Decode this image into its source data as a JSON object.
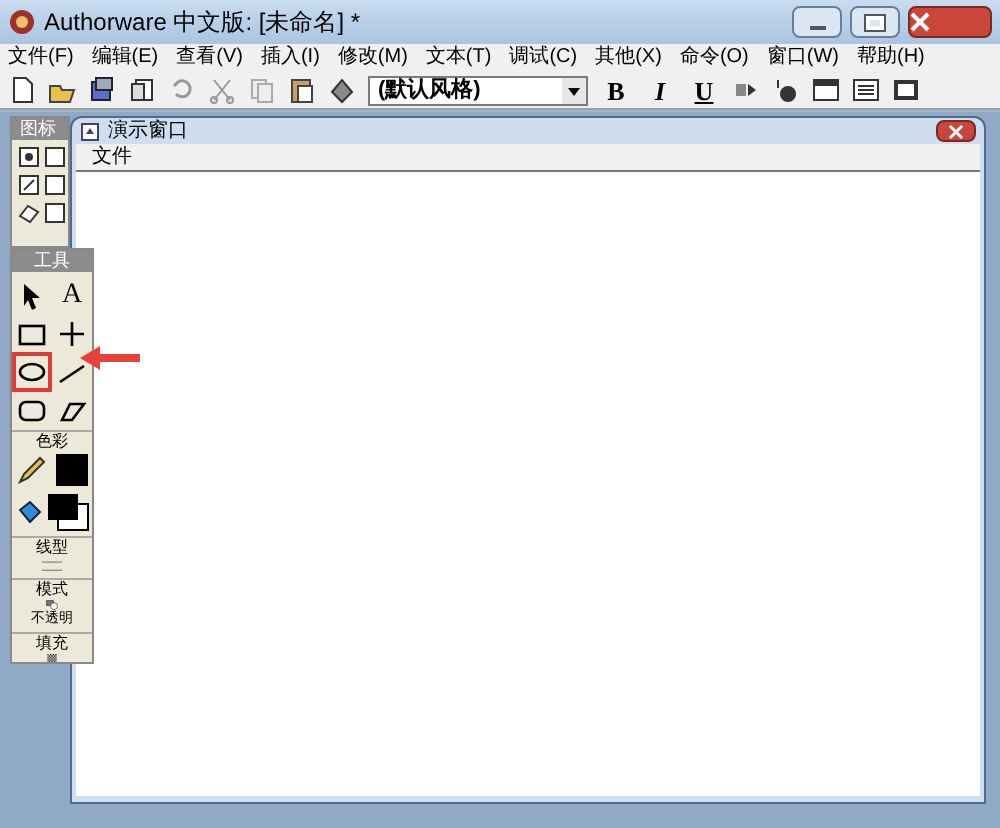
{
  "window": {
    "title": "Authorware 中文版: [未命名] *"
  },
  "menu": [
    "文件(F)",
    "编辑(E)",
    "查看(V)",
    "插入(I)",
    "修改(M)",
    "文本(T)",
    "调试(C)",
    "其他(X)",
    "命令(O)",
    "窗口(W)",
    "帮助(H)"
  ],
  "toolbar": {
    "style_dropdown": "(默认风格)",
    "format_buttons": [
      "B",
      "I",
      "U"
    ]
  },
  "icon_palette": {
    "title": "图标"
  },
  "presentation_window": {
    "title": "演示窗口",
    "menu": [
      "文件"
    ]
  },
  "tools_palette": {
    "title": "工具",
    "tools": [
      {
        "kind": "pointer",
        "selected": false
      },
      {
        "kind": "text",
        "label": "A",
        "selected": false
      },
      {
        "kind": "rectangle",
        "selected": false
      },
      {
        "kind": "cross",
        "selected": false
      },
      {
        "kind": "ellipse",
        "selected": true
      },
      {
        "kind": "line",
        "selected": false
      },
      {
        "kind": "rounded",
        "selected": false
      },
      {
        "kind": "polygon",
        "selected": false
      }
    ],
    "color_label": "色彩",
    "line_label": "线型",
    "mode_label": "模式",
    "mode_value": "不透明",
    "fill_label": "填充"
  },
  "callout": {
    "kind": "arrow"
  }
}
